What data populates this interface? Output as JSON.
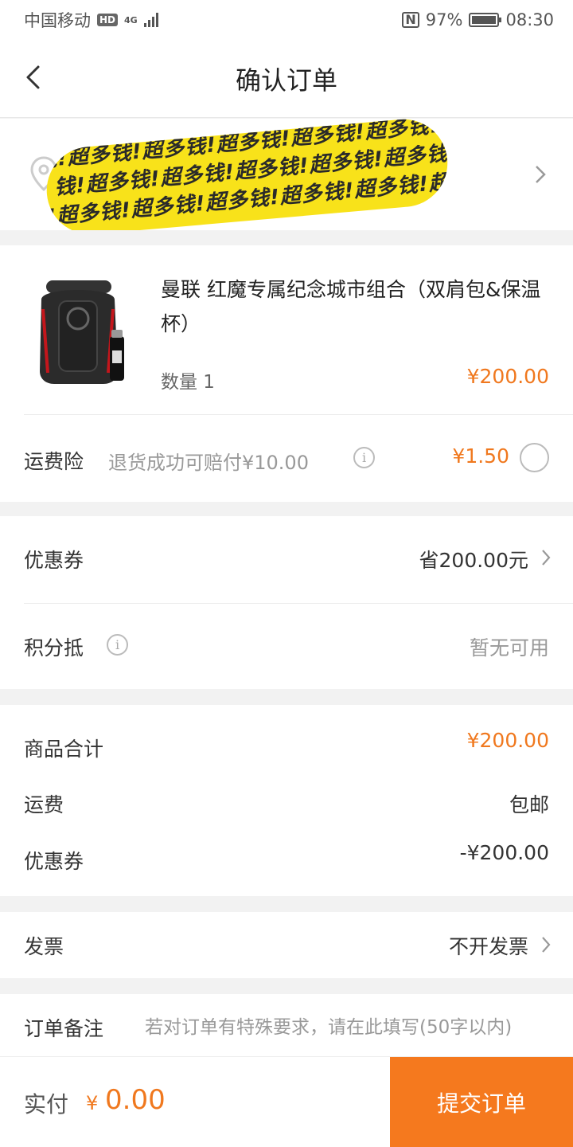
{
  "status_bar": {
    "carrier": "中国移动",
    "hd_badge": "HD",
    "network": "4G",
    "nfc": "N",
    "battery_pct": "97%",
    "battery_level": 0.97,
    "time": "08:30"
  },
  "header": {
    "title": "确认订单"
  },
  "address": {
    "redacted_text": "钱!超多钱!超多钱!超多钱!超多钱!超多钱!超多钱!超多钱!超多钱!超多"
  },
  "product": {
    "title": "曼联 红魔专属纪念城市组合（双肩包&保温杯）",
    "quantity_label": "数量 1",
    "price": "¥200.00"
  },
  "insurance": {
    "label": "运费险",
    "description": "退货成功可赔付¥10.00",
    "price": "¥1.50",
    "info_glyph": "i"
  },
  "coupon_row": {
    "label": "优惠券",
    "value": "省200.00元"
  },
  "points_row": {
    "label": "积分抵",
    "value": "暂无可用",
    "info_glyph": "i"
  },
  "summary": {
    "subtotal_label": "商品合计",
    "subtotal_value": "¥200.00",
    "shipping_label": "运费",
    "shipping_value": "包邮",
    "coupon_label": "优惠券",
    "coupon_value": "-¥200.00"
  },
  "invoice": {
    "label": "发票",
    "value": "不开发票"
  },
  "notes": {
    "label": "订单备注",
    "placeholder": "若对订单有特殊要求，请在此填写(50字以内)"
  },
  "footer": {
    "pay_label": "实付",
    "currency": "¥",
    "amount": "0.00",
    "submit_label": "提交订单"
  },
  "colors": {
    "accent": "#f5791e",
    "price": "#f0781e",
    "redaction": "#f8e21a"
  }
}
